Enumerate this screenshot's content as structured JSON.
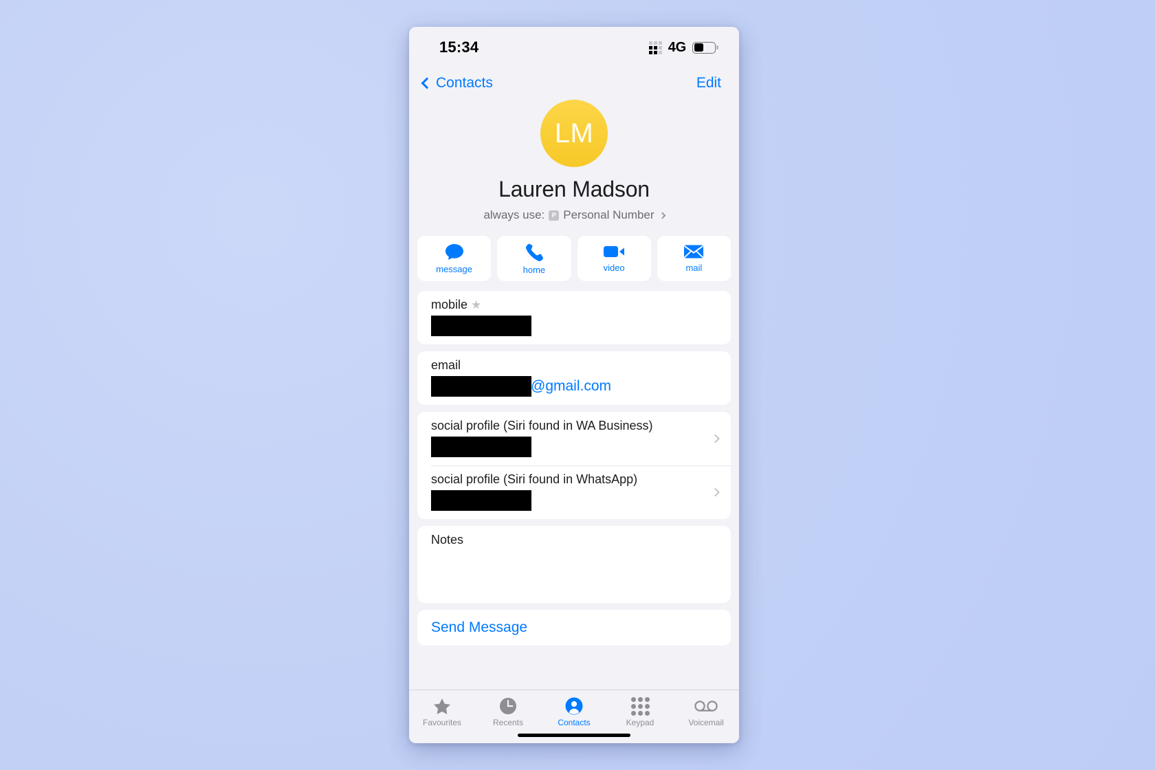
{
  "status_bar": {
    "time": "15:34",
    "network": "4G",
    "signal_icon": "signal-dots-icon",
    "battery_icon": "battery-icon",
    "battery_level_percent": 46
  },
  "nav_bar": {
    "back_label": "Contacts",
    "back_icon": "chevron-left-icon",
    "edit_label": "Edit"
  },
  "contact": {
    "initials": "LM",
    "name": "Lauren Madson",
    "avatar_color": "#f7c928",
    "always_use_prefix": "always use:",
    "sim_badge": "P",
    "always_use_value": "Personal Number",
    "disclosure_icon": "chevron-right-icon"
  },
  "actions": [
    {
      "label": "message",
      "icon": "message-bubble-icon"
    },
    {
      "label": "home",
      "icon": "phone-icon"
    },
    {
      "label": "video",
      "icon": "video-camera-icon"
    },
    {
      "label": "mail",
      "icon": "envelope-icon"
    }
  ],
  "fields": {
    "phone_group": [
      {
        "label": "mobile",
        "favorite_icon": "star-icon",
        "value": "",
        "redacted": true
      }
    ],
    "email_group": [
      {
        "label": "email",
        "value_redacted": true,
        "value_suffix": "@gmail.com"
      }
    ],
    "social_group": [
      {
        "label": "social profile (Siri found in WA Business)",
        "value": "",
        "redacted": true,
        "disclosure_icon": "chevron-right-icon"
      },
      {
        "label": "social profile (Siri found in WhatsApp)",
        "value": "",
        "redacted": true,
        "disclosure_icon": "chevron-right-icon"
      }
    ],
    "notes_group": [
      {
        "label": "Notes",
        "value": ""
      }
    ],
    "action_links": [
      {
        "label": "Send Message"
      }
    ]
  },
  "tab_bar": [
    {
      "label": "Favourites",
      "icon": "star-icon",
      "active": false
    },
    {
      "label": "Recents",
      "icon": "clock-icon",
      "active": false
    },
    {
      "label": "Contacts",
      "icon": "person-circle-icon",
      "active": true
    },
    {
      "label": "Keypad",
      "icon": "keypad-dots-icon",
      "active": false
    },
    {
      "label": "Voicemail",
      "icon": "voicemail-icon",
      "active": false
    }
  ],
  "colors": {
    "accent": "#007aff",
    "avatar": "#f7c928",
    "inactive_tab": "#8e8e93",
    "page_bg": "#f2f2f7"
  }
}
